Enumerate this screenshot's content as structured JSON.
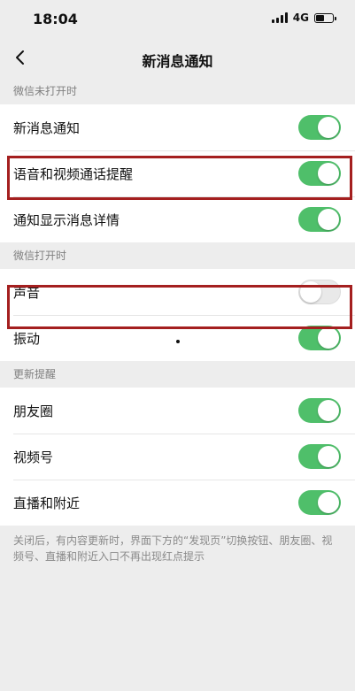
{
  "status": {
    "time": "18:04",
    "network": "4G"
  },
  "nav": {
    "title": "新消息通知"
  },
  "sections": [
    {
      "header": "微信未打开时",
      "rows": [
        {
          "label": "新消息通知",
          "on": true
        },
        {
          "label": "语音和视频通话提醒",
          "on": true
        },
        {
          "label": "通知显示消息详情",
          "on": true
        }
      ]
    },
    {
      "header": "微信打开时",
      "rows": [
        {
          "label": "声音",
          "on": false
        },
        {
          "label": "振动",
          "on": true
        }
      ]
    },
    {
      "header": "更新提醒",
      "rows": [
        {
          "label": "朋友圈",
          "on": true
        },
        {
          "label": "视频号",
          "on": true
        },
        {
          "label": "直播和附近",
          "on": true
        }
      ]
    }
  ],
  "footer": "关闭后，有内容更新时，界面下方的“发现页”切换按钮、朋友圈、视频号、直播和附近入口不再出现红点提示",
  "colors": {
    "toggle_on": "#4fbf6a",
    "toggle_off": "#e9e9e9",
    "highlight": "#a41f1f",
    "background": "#ededed"
  }
}
